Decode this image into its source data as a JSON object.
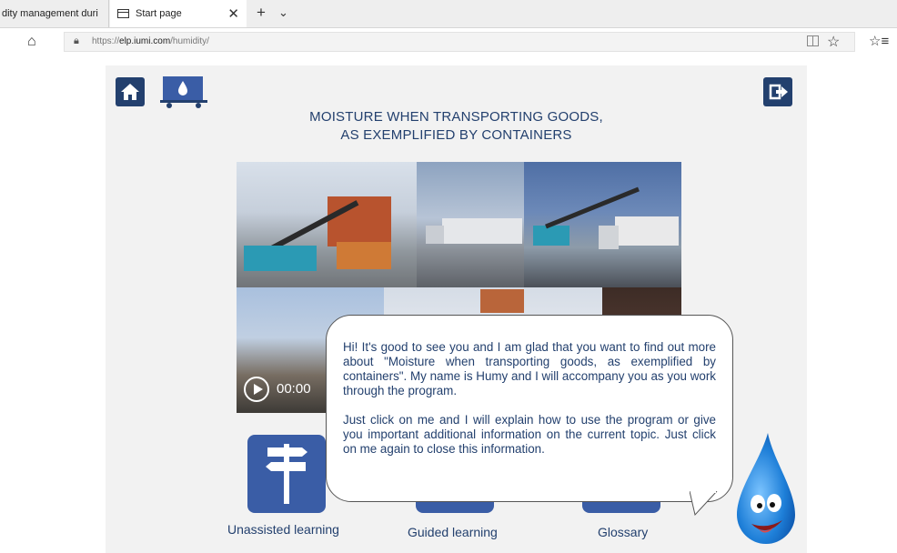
{
  "browser": {
    "tabs": [
      {
        "label": "dity management duri"
      },
      {
        "label": "Start page"
      }
    ],
    "url_prefix": "https://",
    "url_domain": "elp.iumi.com",
    "url_path": "/humidity/"
  },
  "app": {
    "title_line1": "MOISTURE WHEN TRANSPORTING GOODS,",
    "title_line2": "AS EXEMPLIFIED BY CONTAINERS",
    "video_time": "00:00",
    "tiles": [
      {
        "label": "Unassisted learning"
      },
      {
        "label": "Guided learning"
      },
      {
        "label": "Glossary"
      }
    ],
    "bubble": {
      "paragraph1": "Hi! It's good to see you and I am glad that you want to find out more about \"Moisture when transporting goods, as exemplified by containers\". My name is Humy and I will accompany you as you work through the program.",
      "paragraph2": "Just click on me and I will explain how to use the program or give you important additional information on the current topic. Just click on me again to close this information."
    }
  },
  "colors": {
    "primary_dark_blue": "#23406e",
    "tile_blue": "#3a5da6",
    "panel_background": "#f2f2f2",
    "drop_blue": "#1e7fd8"
  }
}
